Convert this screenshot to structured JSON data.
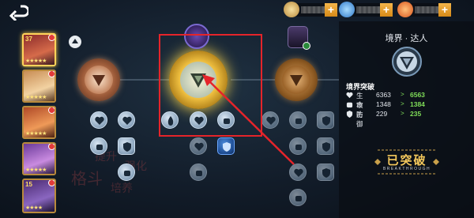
{
  "top_bar": {
    "back_icon": "back-arrow-icon",
    "currencies": [
      {
        "icon": "hero-avatar-icon",
        "color": "#e8c878",
        "plus": "+"
      },
      {
        "icon": "gem-icon",
        "color": "#5fb6ff",
        "plus": "+"
      },
      {
        "icon": "fire-coin-icon",
        "color": "#ff8a3c",
        "plus": "+"
      }
    ]
  },
  "heroes": [
    {
      "level": "37",
      "stars": "★★★★★",
      "colors": [
        "#8a2a2a",
        "#d66b4a"
      ]
    },
    {
      "level": "",
      "stars": "★★★★★",
      "colors": [
        "#c88d55",
        "#f2d2a2"
      ]
    },
    {
      "level": "",
      "stars": "★★★★★",
      "colors": [
        "#b04a28",
        "#ef9a58"
      ]
    },
    {
      "level": "",
      "stars": "★★★★★",
      "colors": [
        "#6b3a9a",
        "#c98be0"
      ]
    },
    {
      "level": "15",
      "stars": "★★★★",
      "colors": [
        "#4a2a70",
        "#8a66c0"
      ]
    }
  ],
  "realm": {
    "orbs": [
      "bronze",
      "gold",
      "bronze-dim"
    ]
  },
  "bg_text": [
    "提升",
    "强化",
    "培养",
    "格斗"
  ],
  "panel": {
    "title": "境界 · 达人",
    "section_title": "境界突破",
    "stats": [
      {
        "icon": "heart-icon",
        "label": "生命",
        "value": "6363",
        "arrow": ">",
        "new_value": "6563"
      },
      {
        "icon": "fist-icon",
        "label": "攻击",
        "value": "1348",
        "arrow": ">",
        "new_value": "1384"
      },
      {
        "icon": "shield-icon",
        "label": "防御",
        "value": "229",
        "arrow": ">",
        "new_value": "235"
      }
    ],
    "badge_main": "已突破",
    "badge_sub": "BREAKTHROUGH"
  },
  "colors": {
    "highlight": "#e5242a",
    "green_stat": "#7fdc58",
    "gold": "#f4c85c"
  }
}
